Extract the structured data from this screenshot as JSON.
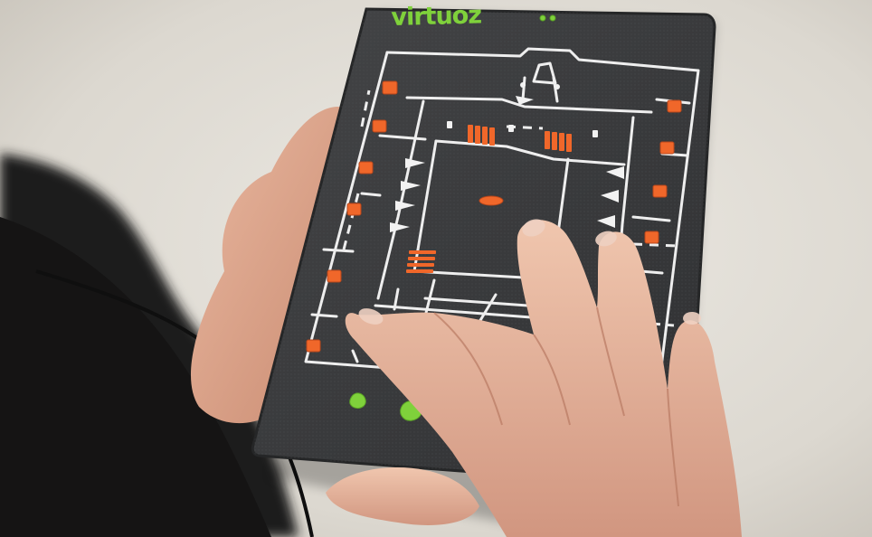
{
  "device": {
    "brand_text": "virtuoz",
    "colors": {
      "brand_green": "#7fd13b",
      "tile_orange": "#f0672a",
      "board_gray": "#3c3d3f",
      "line_white": "#f2f2f2"
    }
  },
  "scene": {
    "icons": [
      "hand-icon",
      "tactile-map-icon",
      "cable-icon"
    ]
  }
}
